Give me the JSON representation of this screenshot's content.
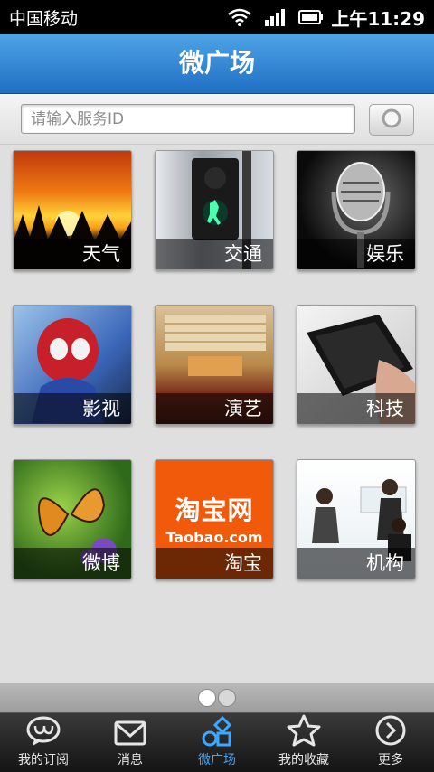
{
  "status": {
    "carrier": "中国移动",
    "time": "上午11:29"
  },
  "title": "微广场",
  "search": {
    "placeholder": "请输入服务ID"
  },
  "tiles": [
    {
      "label": "天气"
    },
    {
      "label": "交通"
    },
    {
      "label": "娱乐"
    },
    {
      "label": "影视"
    },
    {
      "label": "演艺"
    },
    {
      "label": "科技"
    },
    {
      "label": "微博"
    },
    {
      "label": "淘宝",
      "logo": "淘宝网",
      "logo_sub": "Taobao.com"
    },
    {
      "label": "机构"
    }
  ],
  "tabs": [
    {
      "label": "我的订阅",
      "icon": "chat-bubble-icon"
    },
    {
      "label": "消息",
      "icon": "envelope-icon"
    },
    {
      "label": "微广场",
      "icon": "square-plaza-icon"
    },
    {
      "label": "我的收藏",
      "icon": "star-icon"
    },
    {
      "label": "更多",
      "icon": "arrow-circle-icon"
    }
  ],
  "colors": {
    "accent": "#3ea7ff",
    "titlebar": "#2b7fd0",
    "taobao": "#f05a0a"
  }
}
